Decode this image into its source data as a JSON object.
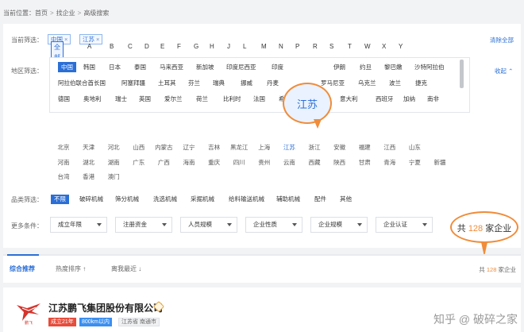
{
  "breadcrumb": [
    "当前位置：",
    "首页",
    "找企业",
    "高级搜索"
  ],
  "current_filter": {
    "label": "当前筛选：",
    "chips": [
      "中国",
      "江苏"
    ],
    "chip_close": "×",
    "clear_all": "清除全部"
  },
  "region": {
    "label": "地区筛选：",
    "letters": [
      "全部",
      "A",
      "B",
      "C",
      "D",
      "E",
      "F",
      "G",
      "H",
      "J",
      "L",
      "M",
      "N",
      "P",
      "R",
      "S",
      "T",
      "W",
      "X",
      "Y"
    ],
    "collapse": "收起",
    "countries_row1": [
      "中国",
      "韩国",
      "日本",
      "泰国",
      "马来西亚",
      "新加坡",
      "印度尼西亚",
      "印度",
      "伊朗",
      "约旦",
      "黎巴嫩",
      "沙特阿拉伯"
    ],
    "countries_row2": [
      "阿拉伯联合酋长国",
      "阿塞拜疆",
      "土耳其",
      "芬兰",
      "瑞典",
      "挪威",
      "丹麦",
      "罗马尼亚",
      "乌克兰",
      "波兰",
      "捷克"
    ],
    "countries_row3": [
      "德国",
      "奥地利",
      "瑞士",
      "英国",
      "爱尔兰",
      "荷兰",
      "比利时",
      "法国",
      "希腊",
      "意大利",
      "西班牙",
      "加纳",
      "南非"
    ],
    "provinces_row1": [
      "北京",
      "天津",
      "河北",
      "山西",
      "内蒙古",
      "辽宁",
      "吉林",
      "黑龙江",
      "上海",
      "江苏",
      "浙江",
      "安徽",
      "福建",
      "江西",
      "山东"
    ],
    "provinces_row2": [
      "河南",
      "湖北",
      "湖南",
      "广东",
      "广西",
      "海南",
      "重庆",
      "四川",
      "贵州",
      "云南",
      "西藏",
      "陕西",
      "甘肃",
      "青海",
      "宁夏",
      "新疆"
    ],
    "provinces_row3": [
      "台湾",
      "香港",
      "澳门"
    ],
    "callout": "江苏"
  },
  "category": {
    "label": "品类筛选：",
    "items": [
      "不限",
      "破碎机械",
      "筛分机械",
      "洗选机械",
      "采掘机械",
      "给料输送机械",
      "辅助机械",
      "配件",
      "其他"
    ]
  },
  "more": {
    "label": "更多条件：",
    "dropdowns": [
      "成立年限",
      "注册资金",
      "人员规模",
      "企业性质",
      "企业规模",
      "企业认证"
    ]
  },
  "count_callout": {
    "prefix": "共 ",
    "count": "128",
    "suffix": " 家企业"
  },
  "sort": {
    "items": [
      "综合推荐",
      "热度排序 ↑",
      "离我最近 ↓"
    ],
    "total_prefix": "共 ",
    "total_count": "128",
    "total_suffix": " 家企业"
  },
  "company": {
    "name": "江苏鹏飞集团股份有限公司",
    "tags": [
      "成立21年",
      "800km以内",
      "江苏省 南通市"
    ],
    "logo_text": "鹏飞"
  },
  "watermark": "知乎 @ 破碎之家"
}
